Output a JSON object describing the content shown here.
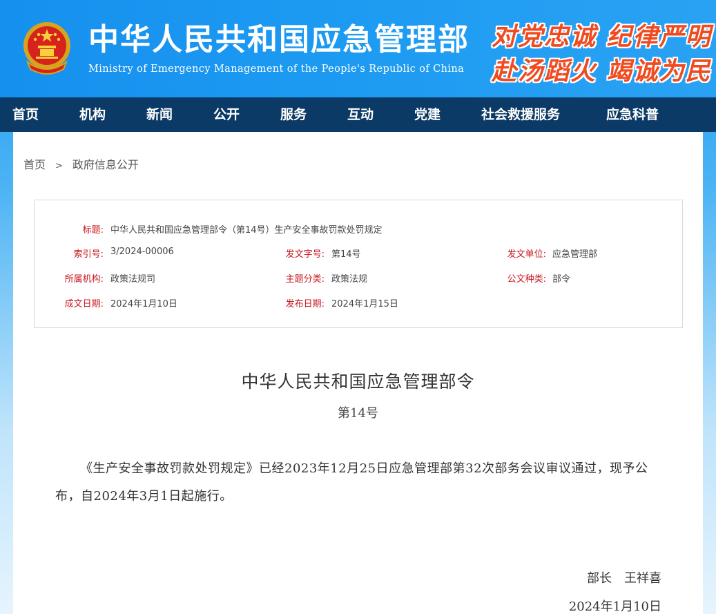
{
  "header": {
    "title": "中华人民共和国应急管理部",
    "subtitle": "Ministry of Emergency Management of the People's Republic of China",
    "slogan_line1": "对党忠诚 纪律严明",
    "slogan_line2": "赴汤蹈火 竭诚为民",
    "emblem_icon": "national-emblem-icon"
  },
  "nav": {
    "items": [
      {
        "label": "首页"
      },
      {
        "label": "机构"
      },
      {
        "label": "新闻"
      },
      {
        "label": "公开"
      },
      {
        "label": "服务"
      },
      {
        "label": "互动"
      },
      {
        "label": "党建"
      },
      {
        "label": "社会救援服务"
      },
      {
        "label": "应急科普"
      }
    ]
  },
  "breadcrumb": {
    "home": "首页",
    "separator": ">",
    "current": "政府信息公开"
  },
  "info": {
    "title_label": "标题:",
    "title_value": "中华人民共和国应急管理部令（第14号）生产安全事故罚款处罚规定",
    "index_label": "索引号:",
    "index_value": "3/2024-00006",
    "doc_no_label": "发文字号:",
    "doc_no_value": "第14号",
    "issuer_label": "发文单位:",
    "issuer_value": "应急管理部",
    "org_label": "所属机构:",
    "org_value": "政策法规司",
    "topic_label": "主题分类:",
    "topic_value": "政策法规",
    "type_label": "公文种类:",
    "type_value": "部令",
    "created_label": "成文日期:",
    "created_value": "2024年1月10日",
    "published_label": "发布日期:",
    "published_value": "2024年1月15日"
  },
  "document": {
    "title": "中华人民共和国应急管理部令",
    "number": "第14号",
    "body": "《生产安全事故罚款处罚规定》已经2023年12月25日应急管理部第32次部务会议审议通过，现予公布，自2024年3月1日起施行。",
    "signature": "部长　王祥喜",
    "date": "2024年1月10日"
  },
  "colors": {
    "header_blue": "#1d9bf2",
    "nav_navy": "#0b3a66",
    "label_red": "#c8161d",
    "slogan_orange": "#f04a1f"
  }
}
